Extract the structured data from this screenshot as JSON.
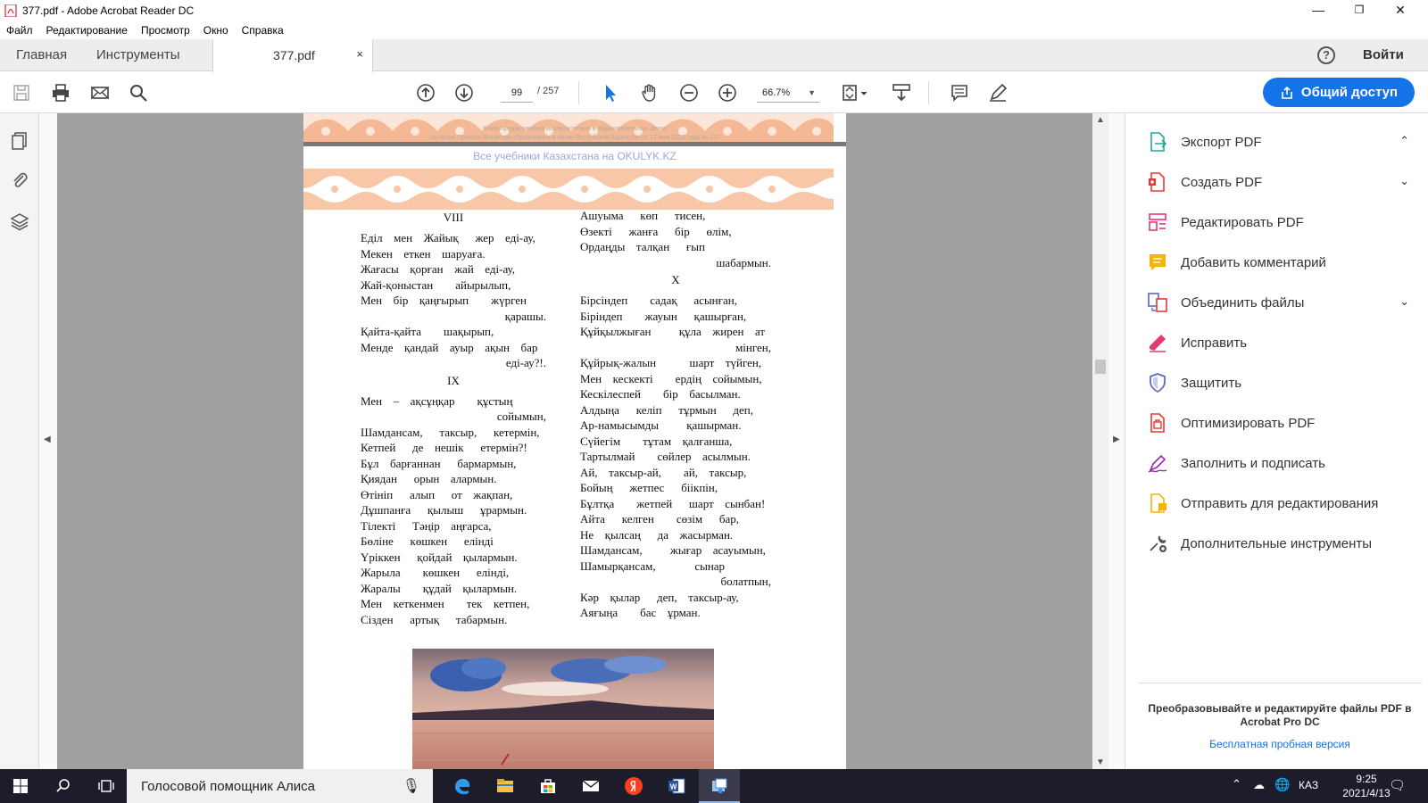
{
  "window": {
    "title": "377.pdf - Adobe Acrobat Reader DC",
    "controls": {
      "minimize": "—",
      "maximize": "❐",
      "close": "✕"
    }
  },
  "menu": [
    "Файл",
    "Редактирование",
    "Просмотр",
    "Окно",
    "Справка"
  ],
  "tabs": {
    "home": "Главная",
    "tools": "Инструменты",
    "doc": "377.pdf",
    "close": "×"
  },
  "header_right": {
    "help": "?",
    "signin": "Войти"
  },
  "toolbar": {
    "page_current": "99",
    "page_total": "/ 257",
    "zoom": "66.7%",
    "share_label": "Общий доступ"
  },
  "document": {
    "prev_footer_line1": "Книга предоставлена исключительно в образовательных целях",
    "prev_footer_line2": "согласно Приказа Министра образования и науки Республики Казахстан от 17 мая 2019 года № 217",
    "watermark": "Все учебники Казахстана на OKULYK.KZ",
    "left_column": [
      {
        "t": "h",
        "text": "VIII"
      },
      {
        "t": "l",
        "text": "Еділ  мен  Жайық   жер  еді-ау,"
      },
      {
        "t": "l",
        "text": "Мекен  еткен  шаруаға."
      },
      {
        "t": "l",
        "text": "Жағасы  қорған  жай  еді-ау,"
      },
      {
        "t": "l",
        "text": "Жай-қоныстан    айырылып,"
      },
      {
        "t": "l",
        "text": "Мен  бір  қаңғырып    жүрген"
      },
      {
        "t": "r",
        "text": "қарашы."
      },
      {
        "t": "l",
        "text": "Қайта-қайта    шақырып,"
      },
      {
        "t": "l",
        "text": "Менде  қандай  ауыр  ақын  бар"
      },
      {
        "t": "r",
        "text": "еді-ау?!."
      },
      {
        "t": "h",
        "text": "IX"
      },
      {
        "t": "l",
        "text": "Мен  –  ақсұңқар    құстың"
      },
      {
        "t": "r",
        "text": "сойымын,"
      },
      {
        "t": "l",
        "text": "Шамдансам,   таксыр,   кетермін,"
      },
      {
        "t": "l",
        "text": "Кетпей   де  нешік   етермін?!"
      },
      {
        "t": "l",
        "text": "Бұл  барғаннан   бармармын,"
      },
      {
        "t": "l",
        "text": "Қиядан   орын  алармын."
      },
      {
        "t": "l",
        "text": "Өтініп   алып   от  жақпан,"
      },
      {
        "t": "l",
        "text": "Дұшпанға   қылыш   ұрармын."
      },
      {
        "t": "l",
        "text": "Тілекті   Тәңір  аңғарса,"
      },
      {
        "t": "l",
        "text": "Бөліне   көшкен   елінді"
      },
      {
        "t": "l",
        "text": "Үріккен   қойдай  қылармын."
      },
      {
        "t": "l",
        "text": "Жарыла    көшкен   елінді,"
      },
      {
        "t": "l",
        "text": "Жаралы    құдай  қылармын."
      },
      {
        "t": "l",
        "text": "Мен  кеткенмен    тек  кетпен,"
      },
      {
        "t": "l",
        "text": "Сізден   артық   табармын."
      }
    ],
    "right_column": [
      {
        "t": "l",
        "text": "Ашуыма   көп   тисен,"
      },
      {
        "t": "l",
        "text": "Өзекті   жанға   бір   өлім,"
      },
      {
        "t": "l",
        "text": "Ордаңды  талқан   ғып"
      },
      {
        "t": "r",
        "text": "шабармын."
      },
      {
        "t": "h",
        "text": "X"
      },
      {
        "t": "l",
        "text": "Бірсіндеп    садақ   асынған,"
      },
      {
        "t": "l",
        "text": "Біріндеп    жауын   қашырған,"
      },
      {
        "t": "l",
        "text": "Құйқылжыған     құла  жирен  ат"
      },
      {
        "t": "r",
        "text": "мінген,"
      },
      {
        "t": "l",
        "text": "Құйрық-жалын      шарт  түйген,"
      },
      {
        "t": "l",
        "text": "Мен  кескекті    ердің  сойымын,"
      },
      {
        "t": "l",
        "text": "Кескілеспей    бір  басылман."
      },
      {
        "t": "l",
        "text": "Алдыңа   келіп   тұрмын   деп,"
      },
      {
        "t": "l",
        "text": "Ар-намысымды     қашырман."
      },
      {
        "t": "l",
        "text": "Сүйегім    тұтам  қалғанша,"
      },
      {
        "t": "l",
        "text": "Тартылмай    сөйлер  асылмын."
      },
      {
        "t": "l",
        "text": "Ай,  таксыр-ай,    ай,  таксыр,"
      },
      {
        "t": "l",
        "text": "Бойың   жетпес   біікпін,"
      },
      {
        "t": "l",
        "text": "Бұлтқа    жетпей   шарт  сынбан!"
      },
      {
        "t": "l",
        "text": "Айта   келген    сөзім   бар,"
      },
      {
        "t": "l",
        "text": "Не  қылсаң   да  жасырман."
      },
      {
        "t": "l",
        "text": "Шамдансам,     жығар  асауымын,"
      },
      {
        "t": "l",
        "text": "Шамырқансам,       сынар"
      },
      {
        "t": "r",
        "text": "болатпын,"
      },
      {
        "t": "l",
        "text": "Кәр  қылар   деп,  таксыр-ау,"
      },
      {
        "t": "l",
        "text": "Аяғыңа    бас  ұрман."
      }
    ]
  },
  "tools_pane": {
    "items": [
      {
        "label": "Экспорт PDF",
        "icon": "export-pdf-icon",
        "chev": "⌃",
        "color": "#26a69a"
      },
      {
        "label": "Создать PDF",
        "icon": "create-pdf-icon",
        "chev": "⌄",
        "color": "#e53935"
      },
      {
        "label": "Редактировать PDF",
        "icon": "edit-pdf-icon",
        "chev": "",
        "color": "#e53970"
      },
      {
        "label": "Добавить комментарий",
        "icon": "comment-icon",
        "chev": "",
        "color": "#f4b400"
      },
      {
        "label": "Объединить файлы",
        "icon": "combine-files-icon",
        "chev": "⌄",
        "color": "#5c6bc0"
      },
      {
        "label": "Исправить",
        "icon": "fix-icon",
        "chev": "",
        "color": "#e53970"
      },
      {
        "label": "Защитить",
        "icon": "protect-icon",
        "chev": "",
        "color": "#5c6bc0"
      },
      {
        "label": "Оптимизировать PDF",
        "icon": "optimize-pdf-icon",
        "chev": "",
        "color": "#e53935"
      },
      {
        "label": "Заполнить и подписать",
        "icon": "fill-sign-icon",
        "chev": "",
        "color": "#9c27b0"
      },
      {
        "label": "Отправить для редактирования",
        "icon": "send-review-icon",
        "chev": "",
        "color": "#f4b400"
      },
      {
        "label": "Дополнительные инструменты",
        "icon": "more-tools-icon",
        "chev": "",
        "color": "#555555"
      }
    ],
    "promo": "Преобразовывайте и редактируйте файлы PDF в Acrobat Pro DC",
    "trial": "Бесплатная пробная версия"
  },
  "taskbar": {
    "search_text": "Голосовой помощник Алиса",
    "lang": "КАЗ",
    "time": "9:25",
    "date": "2021/4/13"
  },
  "colors": {
    "accent": "#1473e6",
    "ornament": "#f6c6a8",
    "taskbar": "#1c1c2a"
  }
}
